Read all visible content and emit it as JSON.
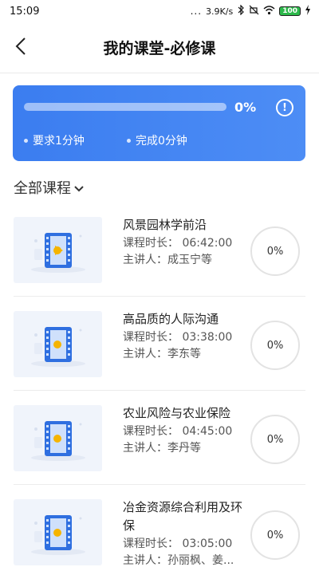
{
  "status_bar": {
    "time": "15:09",
    "dots": "...",
    "net_speed": "3.9K/s",
    "battery": "100",
    "icons": [
      "bluetooth-icon",
      "mute-icon",
      "wifi-icon",
      "battery-icon",
      "charging-icon"
    ]
  },
  "header": {
    "title": "我的课堂-必修课",
    "back_icon": "back-arrow-icon"
  },
  "progress": {
    "percent_label": "0%",
    "fraction": 0,
    "required": "要求1分钟",
    "completed": "完成0分钟",
    "info_icon": "info-icon",
    "info_glyph": "!"
  },
  "filter": {
    "label": "全部课程",
    "chevron_icon": "chevron-down-icon"
  },
  "courses": [
    {
      "title": "风景园林学前沿",
      "duration": "课程时长：  06:42:00",
      "lecturer": "主讲人：成玉宁等",
      "progress": "0%"
    },
    {
      "title": "高品质的人际沟通",
      "duration": "课程时长：  03:38:00",
      "lecturer": "主讲人：李东等",
      "progress": "0%"
    },
    {
      "title": "农业风险与农业保险",
      "duration": "课程时长：  04:45:00",
      "lecturer": "主讲人：李丹等",
      "progress": "0%"
    },
    {
      "title": "冶金资源综合利用及环保",
      "duration": "课程时长：  03:05:00",
      "lecturer": "主讲人：孙丽枫、姜...",
      "progress": "0%"
    }
  ],
  "colors": {
    "card_blue": "#3b7df0",
    "ring_gray": "#e3e3e3",
    "battery_green": "#2cb84a"
  }
}
